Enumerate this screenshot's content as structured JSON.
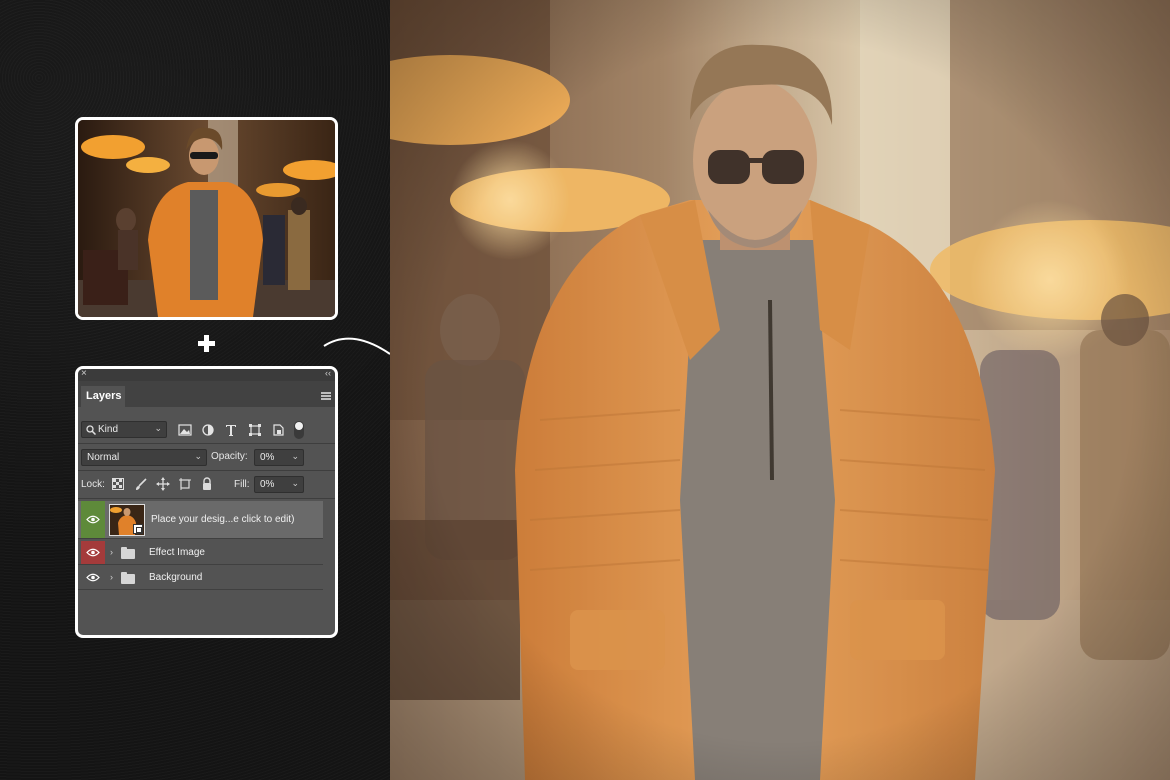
{
  "colors": {
    "background": "#151515",
    "panel": "#535353",
    "visibility_green": "#5e8a3a",
    "visibility_red": "#a43b3b",
    "jacket_orange": "#d9863a",
    "sepia_tone": "#d8c2a0"
  },
  "layers_panel": {
    "close_glyph": "×",
    "collapse_glyph": "‹‹",
    "tab_label": "Layers",
    "filter": {
      "selected": "Kind"
    },
    "blend_mode": {
      "selected": "Normal"
    },
    "opacity_label": "Opacity:",
    "opacity_value": "0%",
    "lock_label": "Lock:",
    "fill_label": "Fill:",
    "fill_value": "0%",
    "layers": [
      {
        "name": "Place your desig...e click to edit)",
        "type": "smart-object",
        "selected": true
      },
      {
        "name": "Effect Image",
        "type": "group"
      },
      {
        "name": "Background",
        "type": "group"
      }
    ]
  },
  "icons": {
    "search": "search-icon",
    "filter_types": [
      "image-filter-icon",
      "adjustment-filter-icon",
      "type-filter-icon",
      "shape-filter-icon",
      "smart-object-filter-icon",
      "filter-toggle-icon"
    ],
    "locks": [
      "lock-transparent-icon",
      "lock-paint-icon",
      "lock-position-icon",
      "lock-artboard-icon",
      "lock-all-icon"
    ]
  }
}
